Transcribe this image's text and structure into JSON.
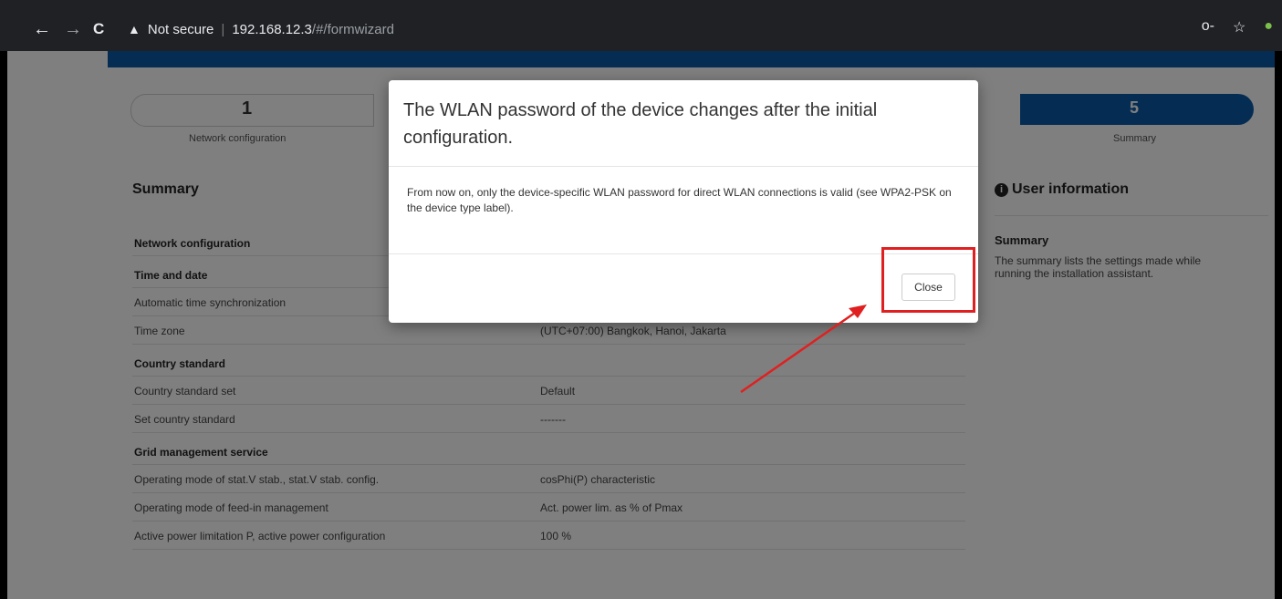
{
  "browser": {
    "back_icon": "←",
    "forward_icon": "→",
    "reload_icon": "C",
    "security_icon": "▲",
    "security_label": "Not secure",
    "url_host": "192.168.12.3",
    "url_path": "/#/formwizard",
    "key_icon": "o-",
    "star_icon": "☆",
    "extension_icon": "●"
  },
  "wizard": {
    "step1": {
      "number": "1",
      "label": "Network configuration"
    },
    "step5": {
      "number": "5",
      "label": "Summary"
    }
  },
  "summary": {
    "title": "Summary",
    "sections": [
      {
        "title": "Network configuration",
        "rows": []
      },
      {
        "title": "Time and date",
        "rows": [
          {
            "label": "Automatic time synchronization",
            "value": ""
          },
          {
            "label": "Time zone",
            "value": "(UTC+07:00) Bangkok, Hanoi, Jakarta"
          }
        ]
      },
      {
        "title": "Country standard",
        "rows": [
          {
            "label": "Country standard set",
            "value": "Default"
          },
          {
            "label": "Set country standard",
            "value": "-------"
          }
        ]
      },
      {
        "title": "Grid management service",
        "rows": [
          {
            "label": "Operating mode of stat.V stab., stat.V stab. config.",
            "value": "cosPhi(P) characteristic"
          },
          {
            "label": "Operating mode of feed-in management",
            "value": "Act. power lim. as % of Pmax"
          },
          {
            "label": "Active power limitation P, active power configuration",
            "value": "100 %"
          }
        ]
      }
    ]
  },
  "user_info": {
    "icon": "i",
    "title": "User information",
    "subtitle": "Summary",
    "text": "The summary lists the settings made while running the installation assistant."
  },
  "dialog": {
    "title": "The WLAN password of the device changes after the initial configuration.",
    "body": "From now on, only the device-specific WLAN password for direct WLAN connections is valid (see WPA2-PSK on the device type label).",
    "close_label": "Close"
  },
  "colors": {
    "accent": "#0b5ba8",
    "annotation": "#e02020"
  }
}
